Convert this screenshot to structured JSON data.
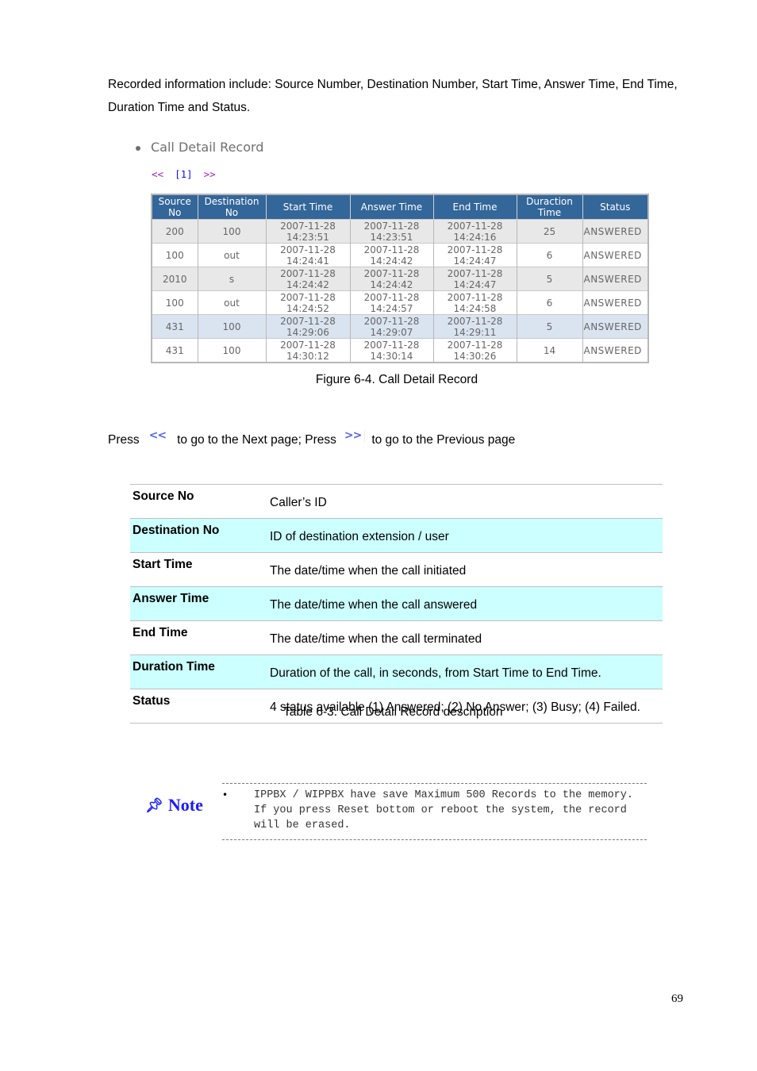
{
  "intro_text": "Recorded information include: Source Number, Destination Number, Start Time, Answer Time, End Time, Duration Time and Status.",
  "cdr_screenshot": {
    "title": "Call Detail Record",
    "pager": {
      "prev": "<<",
      "page": "[1]",
      "next": ">>"
    },
    "columns": [
      "Source No",
      "Destination No",
      "Start Time",
      "Answer Time",
      "End Time",
      "Duraction Time",
      "Status"
    ],
    "rows": [
      {
        "source": "200",
        "destination": "100",
        "start_date": "2007-11-28",
        "start_time": "14:23:51",
        "answer_date": "2007-11-28",
        "answer_time": "14:23:51",
        "end_date": "2007-11-28",
        "end_time": "14:24:16",
        "duration": "25",
        "status": "ANSWERED"
      },
      {
        "source": "100",
        "destination": "out",
        "start_date": "2007-11-28",
        "start_time": "14:24:41",
        "answer_date": "2007-11-28",
        "answer_time": "14:24:42",
        "end_date": "2007-11-28",
        "end_time": "14:24:47",
        "duration": "6",
        "status": "ANSWERED"
      },
      {
        "source": "2010",
        "destination": "s",
        "start_date": "2007-11-28",
        "start_time": "14:24:42",
        "answer_date": "2007-11-28",
        "answer_time": "14:24:42",
        "end_date": "2007-11-28",
        "end_time": "14:24:47",
        "duration": "5",
        "status": "ANSWERED"
      },
      {
        "source": "100",
        "destination": "out",
        "start_date": "2007-11-28",
        "start_time": "14:24:52",
        "answer_date": "2007-11-28",
        "answer_time": "14:24:57",
        "end_date": "2007-11-28",
        "end_time": "14:24:58",
        "duration": "6",
        "status": "ANSWERED"
      },
      {
        "source": "431",
        "destination": "100",
        "start_date": "2007-11-28",
        "start_time": "14:29:06",
        "answer_date": "2007-11-28",
        "answer_time": "14:29:07",
        "end_date": "2007-11-28",
        "end_time": "14:29:11",
        "duration": "5",
        "status": "ANSWERED"
      },
      {
        "source": "431",
        "destination": "100",
        "start_date": "2007-11-28",
        "start_time": "14:30:12",
        "answer_date": "2007-11-28",
        "answer_time": "14:30:14",
        "end_date": "2007-11-28",
        "end_time": "14:30:26",
        "duration": "14",
        "status": "ANSWERED"
      }
    ],
    "colors": {
      "header_bg": "#336699",
      "row_grey": "#e8e8e8",
      "row_highlight": "#dae4f0"
    }
  },
  "figure_caption": "Figure 6-4. Call Detail Record",
  "press_line": {
    "press1": "Press",
    "icon1": "<<",
    "text1": "to go to the Next page; Press",
    "icon2": ">>",
    "text2": "to go to the Previous page"
  },
  "desc_table": {
    "rows": [
      {
        "term": "Source No",
        "definition": "Caller’s ID"
      },
      {
        "term": "Destination No",
        "definition": "ID of destination extension / user"
      },
      {
        "term": "Start Time",
        "definition": "The date/time when the call initiated"
      },
      {
        "term": "Answer Time",
        "definition": "The date/time when the call answered"
      },
      {
        "term": "End Time",
        "definition": "The date/time when the call terminated"
      },
      {
        "term": "Duration Time",
        "definition": "Duration of the call, in seconds, from Start Time to End Time."
      },
      {
        "term": "Status",
        "definition": "4 status available (1) Answered; (2) No Answer; (3) Busy; (4) Failed."
      }
    ],
    "caption": "Table 6-3. Call Detail Record description",
    "highlight_color": "#ccffff"
  },
  "note": {
    "icon": "pushpin-icon",
    "label": "Note",
    "bullet": "•",
    "text": "IPPBX / WIPPBX have save Maximum 500 Records to the memory. If you press Reset bottom or reboot the system, the record will be erased."
  },
  "page_number": "69"
}
